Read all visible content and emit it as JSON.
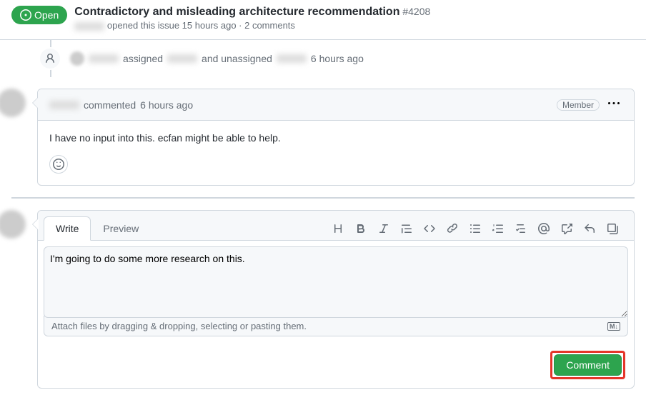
{
  "header": {
    "status": "Open",
    "title": "Contradictory and misleading architecture recommendation",
    "number": "#4208",
    "meta_opened": "opened this issue 15 hours ago · 2 comments"
  },
  "timeline": {
    "assigned_text_1": "assigned",
    "assigned_text_2": "and unassigned",
    "assigned_time": "6 hours ago"
  },
  "comment": {
    "action": "commented",
    "time": "6 hours ago",
    "badge": "Member",
    "body": "I have no input into this. ecfan might be able to help."
  },
  "compose": {
    "tabs": {
      "write": "Write",
      "preview": "Preview"
    },
    "text": "I'm going to do some more research on this.",
    "attach_hint": "Attach files by dragging & dropping, selecting or pasting them.",
    "submit": "Comment"
  }
}
